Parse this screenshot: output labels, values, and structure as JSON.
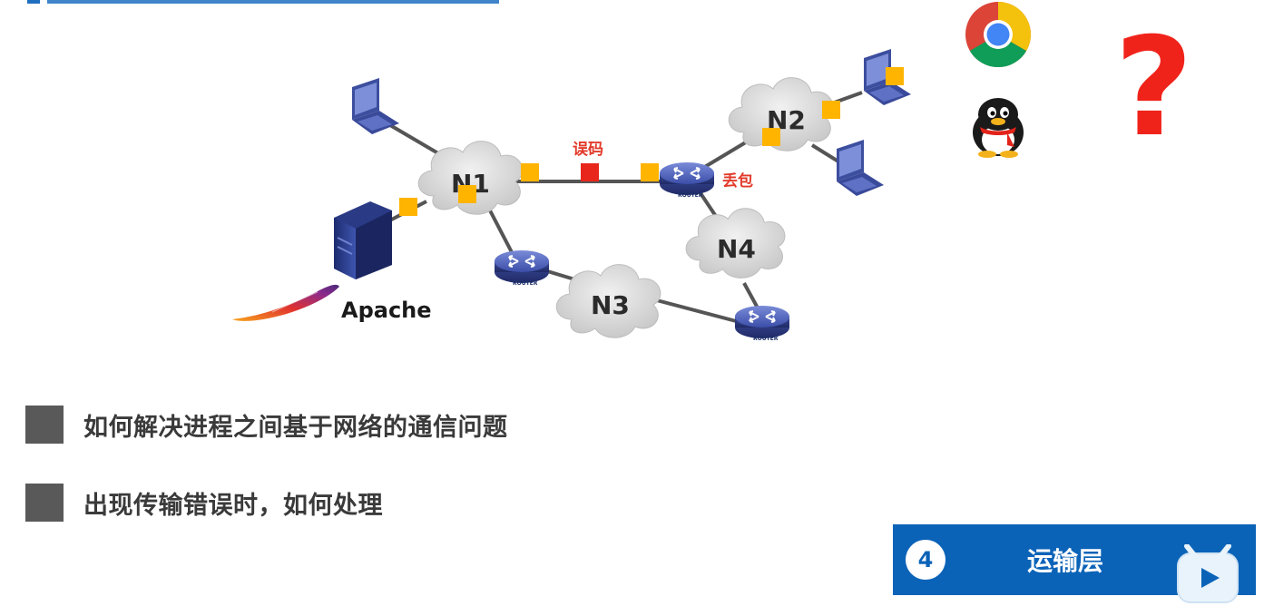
{
  "networks": {
    "n1": "N1",
    "n2": "N2",
    "n3": "N3",
    "n4": "N4"
  },
  "annotations": {
    "bit_error": "误码",
    "packet_loss": "丢包"
  },
  "router_text": "ROUTER",
  "server_label": "Apache",
  "bullets": [
    "如何解决进程之间基于网络的通信问题",
    "出现传输错误时，如何处理"
  ],
  "layer": {
    "number": "4",
    "name": "运输层"
  },
  "apps": {
    "browser_icon": "chrome-icon",
    "chat_icon": "qq-penguin-icon",
    "question_mark": "?"
  },
  "colors": {
    "link_marker": "#ffb400",
    "error_marker": "#e8261c",
    "layer_box": "#0b63b8",
    "question": "#f0231b"
  }
}
